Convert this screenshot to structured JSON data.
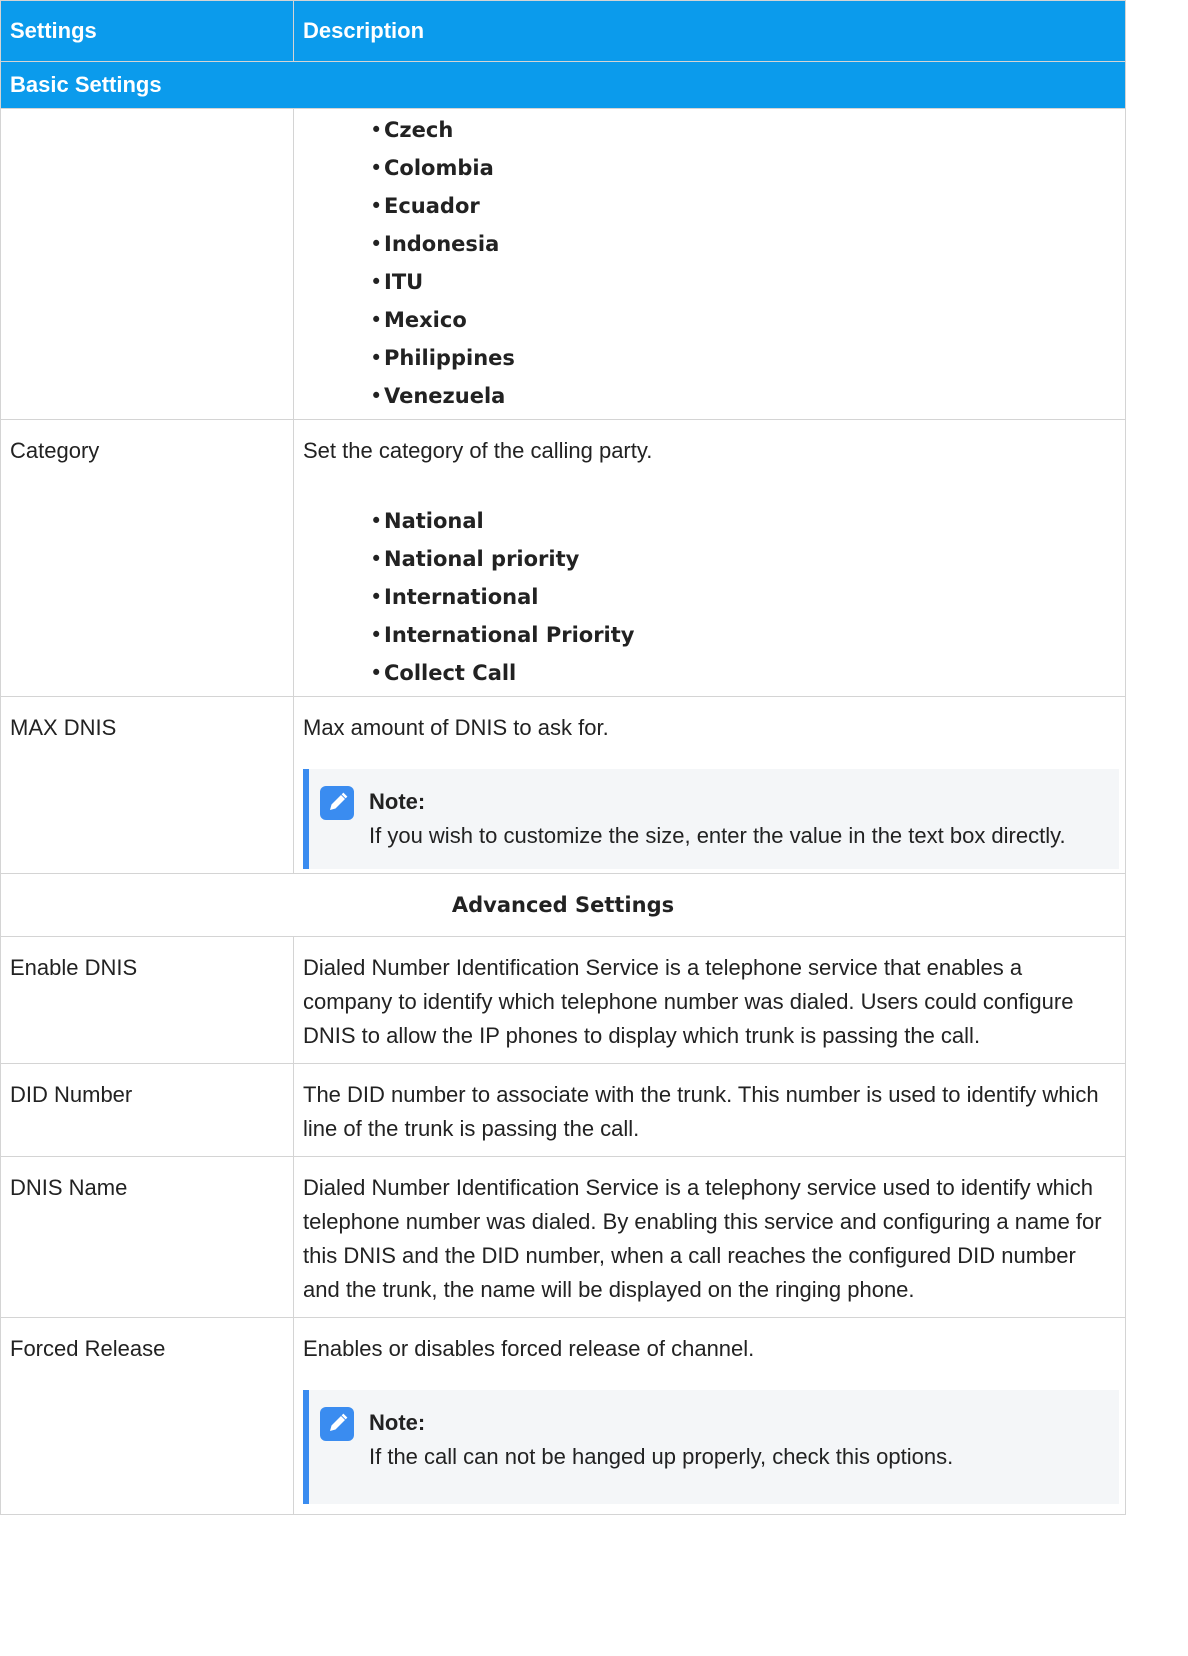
{
  "header": {
    "col1": "Settings",
    "col2": "Description"
  },
  "sections": {
    "basic": "Basic Settings",
    "advanced": "Advanced Settings"
  },
  "country_options": [
    "Czech",
    "Colombia",
    "Ecuador",
    "Indonesia",
    "ITU",
    "Mexico",
    "Philippines",
    "Venezuela"
  ],
  "category": {
    "name": "Category",
    "desc": "Set the category of the calling party.",
    "options": [
      "National",
      "National priority",
      "International",
      "International Priority",
      "Collect Call"
    ]
  },
  "max_dnis": {
    "name": "MAX DNIS",
    "desc": "Max amount of DNIS to ask for.",
    "note_title": "Note:",
    "note_text": "If you wish to customize the size, enter the value in the text box directly."
  },
  "enable_dnis": {
    "name": "Enable DNIS",
    "desc": "Dialed Number Identification Service is a telephone service that enables a company to identify which telephone number was dialed. Users could configure DNIS to allow the IP phones to display which trunk is passing the call."
  },
  "did_number": {
    "name": "DID Number",
    "desc": "The DID number to associate with the trunk. This number is used to identify which line of the trunk is passing the call."
  },
  "dnis_name": {
    "name": "DNIS Name",
    "desc": "Dialed Number Identification Service is a telephony service used to identify which telephone number was dialed. By enabling this service and configuring a name for this DNIS and the DID number, when a call reaches the configured DID number and the trunk, the name will be displayed on the ringing phone."
  },
  "forced_release": {
    "name": "Forced Release",
    "desc": "Enables or disables forced release of channel.",
    "note_title": "Note:",
    "note_text": "If the call can not be hanged up properly, check this options."
  },
  "colors": {
    "header_bg": "#0b9bec",
    "note_accent": "#3a8cf0",
    "note_bg": "#f4f6f8"
  }
}
